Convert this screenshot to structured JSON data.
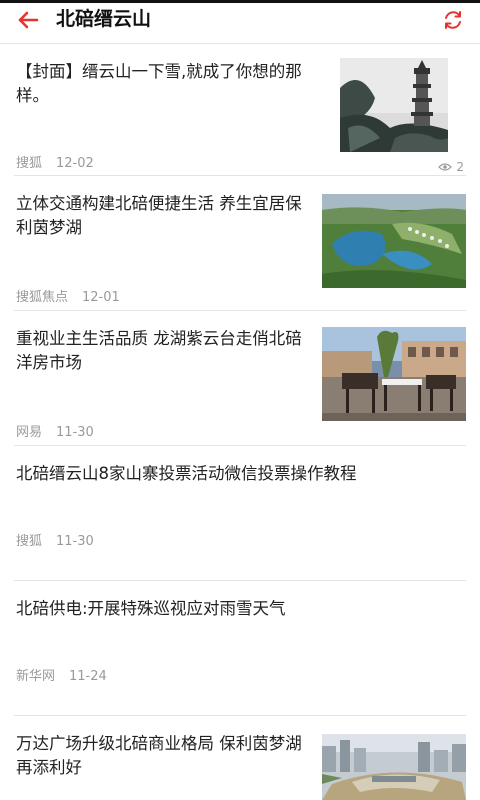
{
  "header": {
    "title": "北碚缙云山"
  },
  "articles": [
    {
      "title": "【封面】缙云山一下雪,就成了你想的那样。",
      "source": "搜狐",
      "date": "12-02",
      "views": "2",
      "thumbnail": "pagoda-in-snow"
    },
    {
      "title": "立体交通构建北碚便捷生活 养生宜居保利茵梦湖",
      "source": "搜狐焦点",
      "date": "12-01",
      "thumbnail": "aerial-lake-community"
    },
    {
      "title": "重视业主生活品质 龙湖紫云台走俏北碚洋房市场",
      "source": "网易",
      "date": "11-30",
      "thumbnail": "terrace-furniture"
    },
    {
      "title": "北碚缙云山8家山寨投票活动微信投票操作教程",
      "source": "搜狐",
      "date": "11-30"
    },
    {
      "title": "北碚供电:开展特殊巡视应对雨雪天气",
      "source": "新华网",
      "date": "11-24"
    },
    {
      "title": "万达广场升级北碚商业格局 保利茵梦湖再添利好",
      "thumbnail": "construction-aerial"
    }
  ],
  "colors": {
    "accent": "#e8322f",
    "meta": "#9a9a9a",
    "divider": "#e4e4e4"
  }
}
